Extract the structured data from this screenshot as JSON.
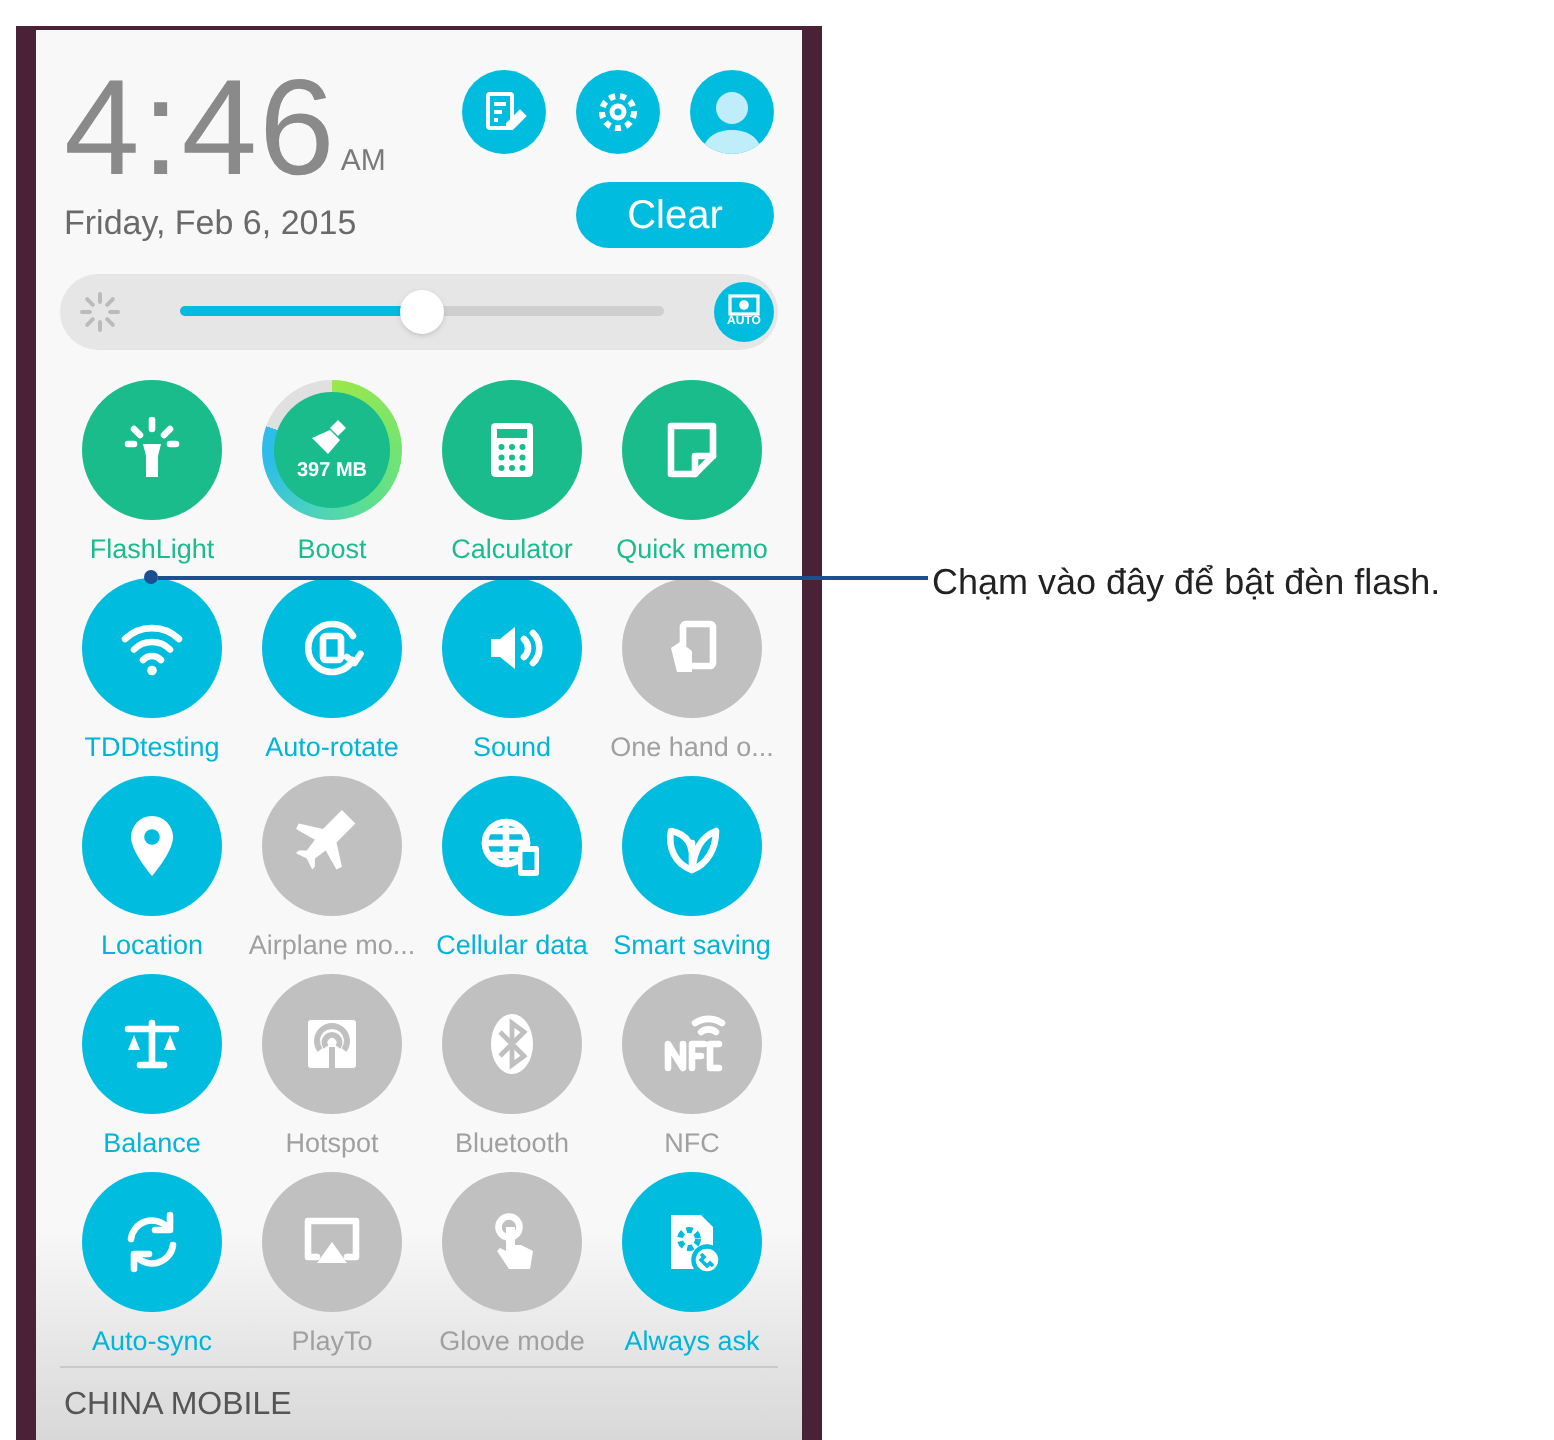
{
  "clock": {
    "time": "4:46",
    "meridiem": "AM",
    "date": "Friday, Feb 6, 2015"
  },
  "clear_button": "Clear",
  "brightness": {
    "level": 0.5,
    "auto": true,
    "auto_label": "AUTO"
  },
  "tiles": [
    {
      "kind": "app",
      "label": "FlashLight"
    },
    {
      "kind": "boost",
      "label": "Boost"
    },
    {
      "kind": "app",
      "label": "Calculator"
    },
    {
      "kind": "app",
      "label": "Quick memo"
    },
    {
      "kind": "toggle",
      "label": "TDDtesting",
      "on": true
    },
    {
      "kind": "toggle",
      "label": "Auto-rotate",
      "on": true
    },
    {
      "kind": "toggle",
      "label": "Sound",
      "on": true
    },
    {
      "kind": "toggle",
      "label": "One hand o...",
      "on": false
    },
    {
      "kind": "toggle",
      "label": "Location",
      "on": true
    },
    {
      "kind": "toggle",
      "label": "Airplane mo...",
      "on": false
    },
    {
      "kind": "toggle",
      "label": "Cellular data",
      "on": true
    },
    {
      "kind": "toggle",
      "label": "Smart saving",
      "on": true
    },
    {
      "kind": "toggle",
      "label": "Balance",
      "on": true
    },
    {
      "kind": "toggle",
      "label": "Hotspot",
      "on": false
    },
    {
      "kind": "toggle",
      "label": "Bluetooth",
      "on": false
    },
    {
      "kind": "toggle",
      "label": "NFC",
      "on": false
    },
    {
      "kind": "toggle",
      "label": "Auto-sync",
      "on": true
    },
    {
      "kind": "toggle",
      "label": "PlayTo",
      "on": false
    },
    {
      "kind": "toggle",
      "label": "Glove mode",
      "on": false
    },
    {
      "kind": "toggle",
      "label": "Always ask",
      "on": true
    }
  ],
  "boost_memory": {
    "value": "397 MB"
  },
  "carrier": "CHINA MOBILE",
  "callout": "Chạm vào đây để bật đèn flash."
}
